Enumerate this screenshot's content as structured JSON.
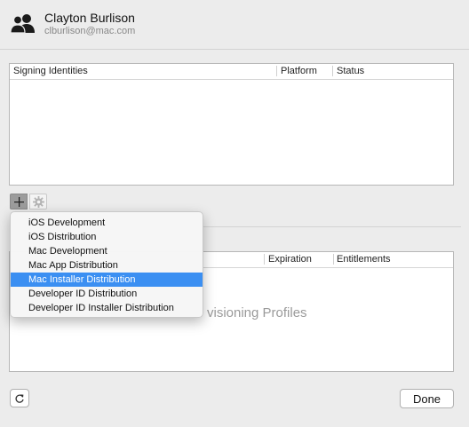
{
  "account": {
    "name": "Clayton Burlison",
    "email": "clburlison@mac.com",
    "icon": "users-icon"
  },
  "signing_table": {
    "columns": [
      "Signing Identities",
      "Platform",
      "Status"
    ]
  },
  "profiles_table": {
    "columns": [
      "Expiration",
      "Entitlements"
    ],
    "empty_message": "Provisioning Profiles",
    "visible_empty_message": "visioning Profiles"
  },
  "toolbar": {
    "add_icon": "plus-icon",
    "action_icon": "gear-icon"
  },
  "add_menu": {
    "items": [
      "iOS Development",
      "iOS Distribution",
      "Mac Development",
      "Mac App Distribution",
      "Mac Installer Distribution",
      "Developer ID Distribution",
      "Developer ID Installer Distribution"
    ],
    "selected_index": 4
  },
  "footer": {
    "refresh_icon": "refresh-icon",
    "done_label": "Done"
  },
  "colors": {
    "selection": "#3b8ff2",
    "window_bg": "#ececec"
  }
}
